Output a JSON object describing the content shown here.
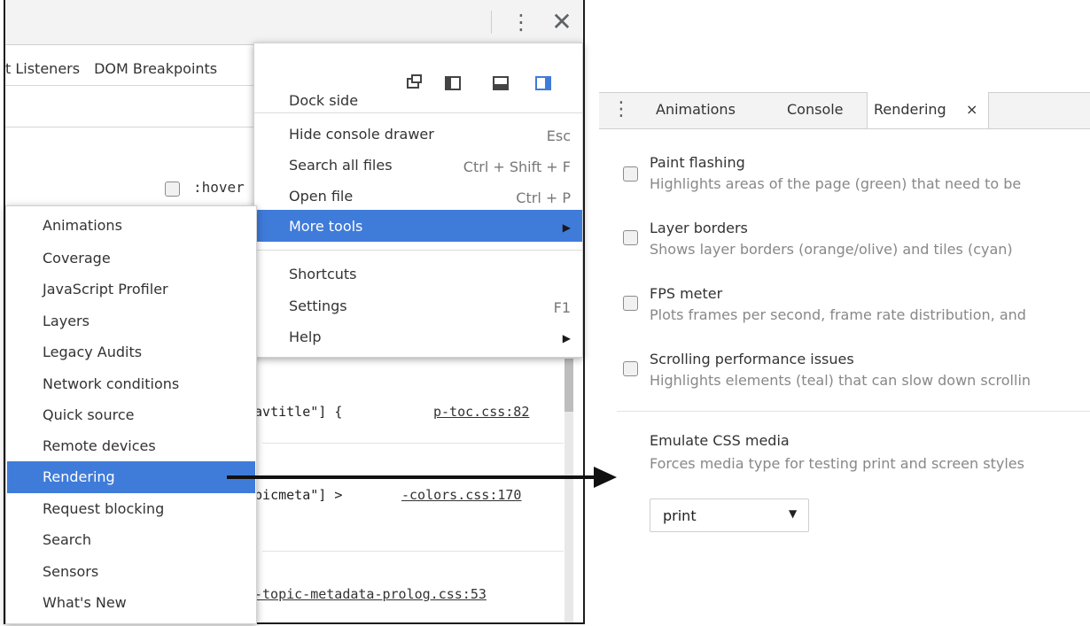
{
  "devtools": {
    "listener_tabs": [
      "t Listeners",
      "DOM Breakpoints"
    ],
    "hover_label": ":hover",
    "code_rules": [
      {
        "selector": "navtitle\"] {",
        "source": "p-toc.css:82"
      },
      {
        "selector": "opicmeta\"] >",
        "source": "-colors.css:170"
      },
      {
        "selector": "",
        "source": "-topic-metadata-prolog.css:53"
      }
    ]
  },
  "main_menu": {
    "dock_side_label": "Dock side",
    "dock_options": [
      "undock-icon",
      "dock-left-icon",
      "dock-bottom-icon",
      "dock-right-icon"
    ],
    "items": [
      {
        "label": "Hide console drawer",
        "shortcut": "Esc"
      },
      {
        "label": "Search all files",
        "shortcut": "Ctrl + Shift + F"
      },
      {
        "label": "Open file",
        "shortcut": "Ctrl + P"
      },
      {
        "label": "More tools",
        "shortcut": "▶"
      },
      {
        "label": "Shortcuts",
        "shortcut": ""
      },
      {
        "label": "Settings",
        "shortcut": "F1"
      },
      {
        "label": "Help",
        "shortcut": "▶"
      }
    ]
  },
  "more_tools": {
    "items": [
      "Animations",
      "Coverage",
      "JavaScript Profiler",
      "Layers",
      "Legacy Audits",
      "Network conditions",
      "Quick source",
      "Remote devices",
      "Rendering",
      "Request blocking",
      "Search",
      "Sensors",
      "What's New"
    ],
    "selected": "Rendering"
  },
  "drawer": {
    "tabs": [
      "Animations",
      "Console",
      "Rendering"
    ],
    "active_tab": "Rendering",
    "close_glyph": "×",
    "options": [
      {
        "title": "Paint flashing",
        "desc": "Highlights areas of the page (green) that need to be"
      },
      {
        "title": "Layer borders",
        "desc": "Shows layer borders (orange/olive) and tiles (cyan)"
      },
      {
        "title": "FPS meter",
        "desc": "Plots frames per second, frame rate distribution, and"
      },
      {
        "title": "Scrolling performance issues",
        "desc": "Highlights elements (teal) that can slow down scrollin"
      }
    ],
    "emulate": {
      "title": "Emulate CSS media",
      "desc": "Forces media type for testing print and screen styles",
      "value": "print"
    }
  },
  "colors": {
    "highlight": "#3f7bd9",
    "dock_active": "#3f7bd9"
  }
}
